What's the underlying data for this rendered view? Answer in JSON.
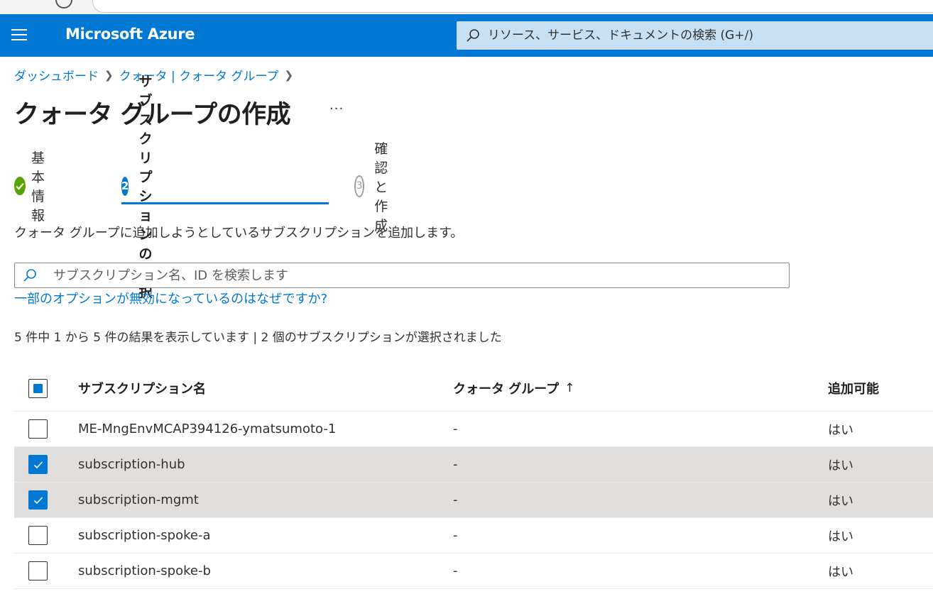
{
  "header": {
    "brand": "Microsoft Azure",
    "search_placeholder": "リソース、サービス、ドキュメントの検索 (G+/)"
  },
  "breadcrumb": [
    {
      "label": "ダッシュボード"
    },
    {
      "label": "クォータ | クォータ グループ"
    }
  ],
  "page": {
    "title": "クォータ グループの作成",
    "more": "···"
  },
  "steps": [
    {
      "label": "基本情報",
      "state": "done"
    },
    {
      "number": "2",
      "label": "サブスクリプションの選択",
      "state": "active"
    },
    {
      "number": "3",
      "label": "確認と作成",
      "state": "pending"
    }
  ],
  "description": "クォータ グループに追加しようとしているサブスクリプションを追加します。",
  "subscription_search": {
    "placeholder": "サブスクリプション名、ID を検索します"
  },
  "disabled_link": "一部のオプションが無効になっているのはなぜですか?",
  "results_summary": "5 件中 1 から 5 件の結果を表示しています | 2 個のサブスクリプションが選択されました",
  "table": {
    "columns": {
      "name": "サブスクリプション名",
      "quota_group": "クォータ グループ",
      "sort_indicator": "↑",
      "can_add": "追加可能"
    },
    "rows": [
      {
        "name": "ME-MngEnvMCAP394126-ymatsumoto-1",
        "quota_group": "-",
        "can_add": "はい",
        "selected": false
      },
      {
        "name": "subscription-hub",
        "quota_group": "-",
        "can_add": "はい",
        "selected": true
      },
      {
        "name": "subscription-mgmt",
        "quota_group": "-",
        "can_add": "はい",
        "selected": true
      },
      {
        "name": "subscription-spoke-a",
        "quota_group": "-",
        "can_add": "はい",
        "selected": false
      },
      {
        "name": "subscription-spoke-b",
        "quota_group": "-",
        "can_add": "はい",
        "selected": false
      }
    ]
  },
  "colors": {
    "brand": "#0078d4",
    "success": "#57a300",
    "selected_row": "#e1dfdd"
  },
  "icons": {
    "menu": "hamburger-icon",
    "search": "search-icon",
    "chevron": "chevron-right-icon",
    "done": "checkmark-circle-icon",
    "check": "checkmark-icon"
  }
}
